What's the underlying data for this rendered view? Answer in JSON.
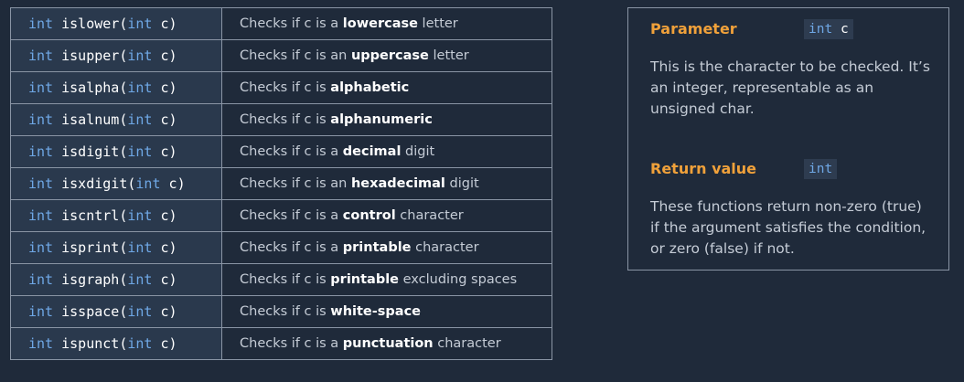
{
  "functions": [
    {
      "ret": "int",
      "name": "islower",
      "param_type": "int",
      "param_name": "c",
      "desc_pre": "Checks if c is a ",
      "desc_hl": "lowercase",
      "desc_post": " letter"
    },
    {
      "ret": "int",
      "name": "isupper",
      "param_type": "int",
      "param_name": "c",
      "desc_pre": "Checks if c is an ",
      "desc_hl": "uppercase",
      "desc_post": " letter"
    },
    {
      "ret": "int",
      "name": "isalpha",
      "param_type": "int",
      "param_name": "c",
      "desc_pre": "Checks if c is ",
      "desc_hl": "alphabetic",
      "desc_post": ""
    },
    {
      "ret": "int",
      "name": "isalnum",
      "param_type": "int",
      "param_name": "c",
      "desc_pre": "Checks if c is ",
      "desc_hl": "alphanumeric",
      "desc_post": ""
    },
    {
      "ret": "int",
      "name": "isdigit",
      "param_type": "int",
      "param_name": "c",
      "desc_pre": "Checks if c is a ",
      "desc_hl": "decimal",
      "desc_post": " digit"
    },
    {
      "ret": "int",
      "name": "isxdigit",
      "param_type": "int",
      "param_name": "c",
      "desc_pre": "Checks if c is an ",
      "desc_hl": "hexadecimal",
      "desc_post": " digit"
    },
    {
      "ret": "int",
      "name": "iscntrl",
      "param_type": "int",
      "param_name": "c",
      "desc_pre": "Checks if c is a ",
      "desc_hl": "control",
      "desc_post": " character"
    },
    {
      "ret": "int",
      "name": "isprint",
      "param_type": "int",
      "param_name": "c",
      "desc_pre": "Checks if c is a ",
      "desc_hl": "printable",
      "desc_post": " character"
    },
    {
      "ret": "int",
      "name": "isgraph",
      "param_type": "int",
      "param_name": "c",
      "desc_pre": "Checks if c is ",
      "desc_hl": "printable",
      "desc_post": " excluding spaces"
    },
    {
      "ret": "int",
      "name": "isspace",
      "param_type": "int",
      "param_name": "c",
      "desc_pre": "Checks if c is ",
      "desc_hl": "white-space",
      "desc_post": ""
    },
    {
      "ret": "int",
      "name": "ispunct",
      "param_type": "int",
      "param_name": "c",
      "desc_pre": "Checks if c is a ",
      "desc_hl": "punctuation",
      "desc_post": " character"
    }
  ],
  "panel": {
    "parameter_heading": "Parameter",
    "parameter_chip_type": "int",
    "parameter_chip_name": "c",
    "parameter_text": "This is the character to be checked. It’s an integer, representable as an unsigned char.",
    "return_heading": "Return value",
    "return_chip_type": "int",
    "return_text": "These functions return non-zero (true) if the argument satisfies the condition, or zero (false) if not."
  },
  "colors": {
    "background": "#1f2a3a",
    "keyword": "#6fa8e6",
    "heading_accent": "#f0a13a"
  }
}
